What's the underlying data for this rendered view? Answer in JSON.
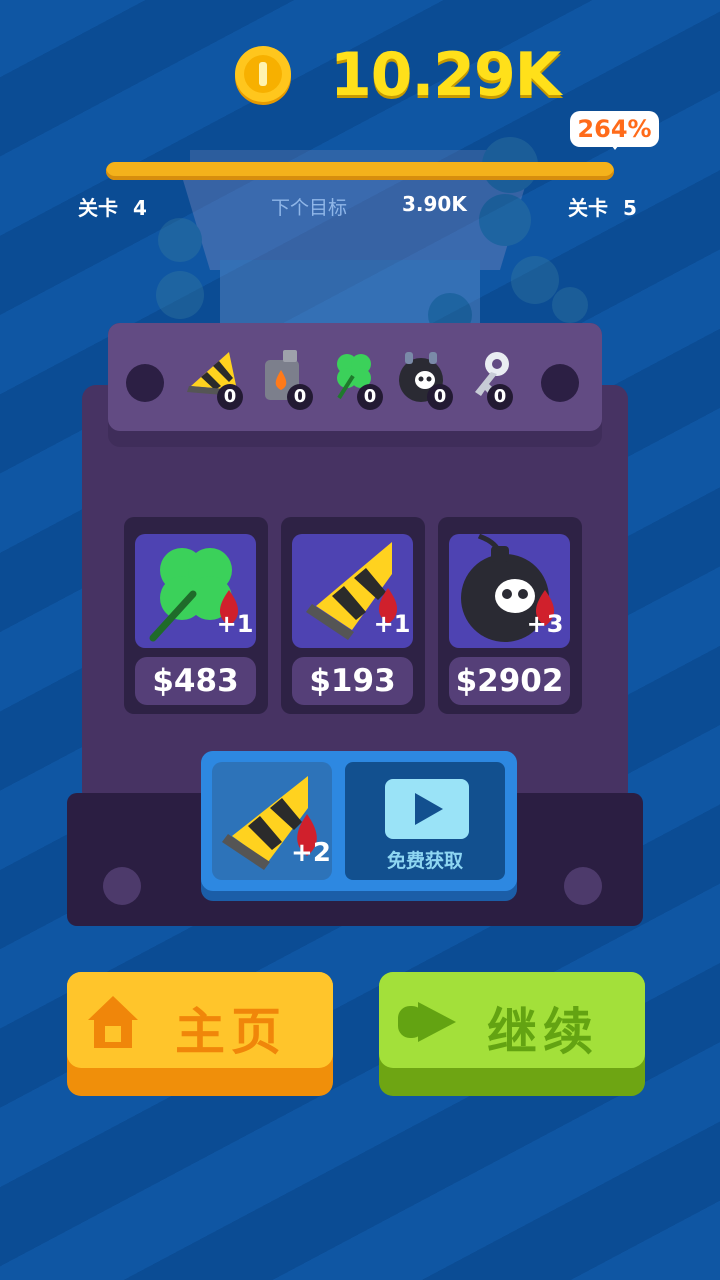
{
  "header": {
    "coin_amount": "10.29K",
    "progress_percent": "264%",
    "progress_fill_fraction": 1.0,
    "level_current_label": "关卡",
    "level_current_value": "4",
    "level_next_label": "关卡",
    "level_next_value": "5",
    "next_goal_label": "下个目标",
    "next_goal_value": "3.90K"
  },
  "inventory": [
    {
      "name": "drill",
      "count": "0"
    },
    {
      "name": "fuel-can",
      "count": "0"
    },
    {
      "name": "clover",
      "count": "0"
    },
    {
      "name": "bomb",
      "count": "0"
    },
    {
      "name": "key",
      "count": "0"
    }
  ],
  "shop": [
    {
      "item": "clover",
      "bonus": "+1",
      "price": "$483"
    },
    {
      "item": "drill",
      "bonus": "+1",
      "price": "$193"
    },
    {
      "item": "bomb",
      "bonus": "+3",
      "price": "$2902"
    }
  ],
  "free_offer": {
    "item": "drill",
    "bonus": "+2",
    "label": "免费获取"
  },
  "buttons": {
    "home_label": "主页",
    "continue_label": "继续"
  },
  "colors": {
    "background": "#0f56a3",
    "coin_text": "#ffe01a",
    "progress": "#f4b21b",
    "percent_text": "#ff6b1a",
    "home_button": "#ffc52b",
    "continue_button": "#a3e03a",
    "machine": "#473363"
  }
}
